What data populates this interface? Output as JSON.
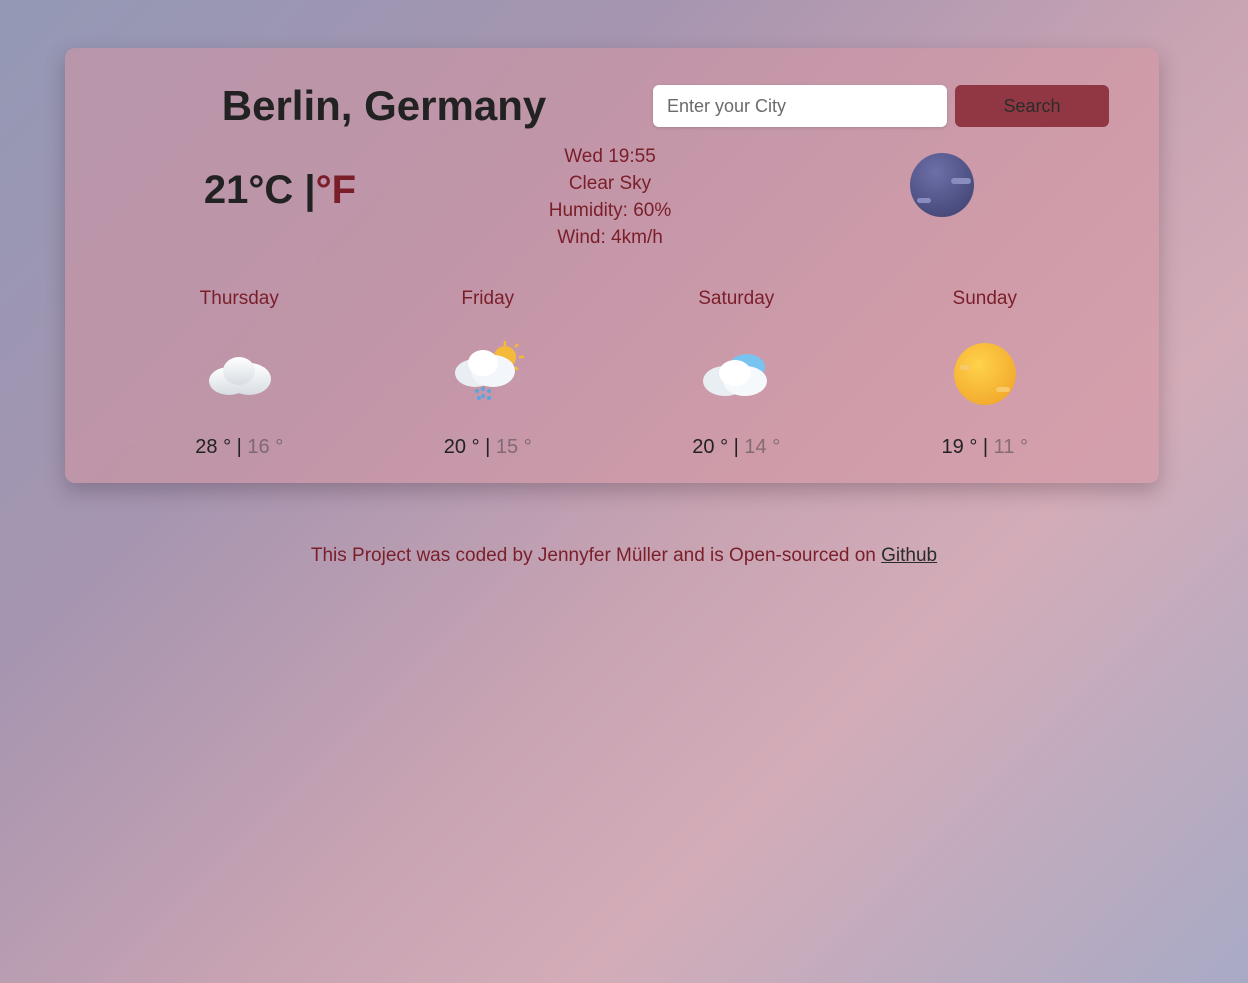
{
  "location": "Berlin, Germany",
  "search": {
    "placeholder": "Enter your City",
    "button": "Search"
  },
  "current": {
    "temp_value": "21",
    "unit_c": "°C",
    "separator": " |",
    "unit_f": "°F",
    "datetime": "Wed 19:55",
    "condition": "Clear Sky",
    "humidity_label": "Humidity: 60%",
    "wind_label": "Wind: 4km/h",
    "icon": "night-foggy"
  },
  "forecast": [
    {
      "name": "Thursday",
      "icon": "cloud",
      "high": "28 °",
      "low": "16 °"
    },
    {
      "name": "Friday",
      "icon": "rain-sun",
      "high": "20 °",
      "low": "15 °"
    },
    {
      "name": "Saturday",
      "icon": "partly-cloudy",
      "high": "20 °",
      "low": "14 °"
    },
    {
      "name": "Sunday",
      "icon": "sun",
      "high": "19 °",
      "low": "11 °"
    }
  ],
  "footer": {
    "text": "This Project was coded by Jennyfer Müller and is Open-sourced on ",
    "link": "Github"
  }
}
